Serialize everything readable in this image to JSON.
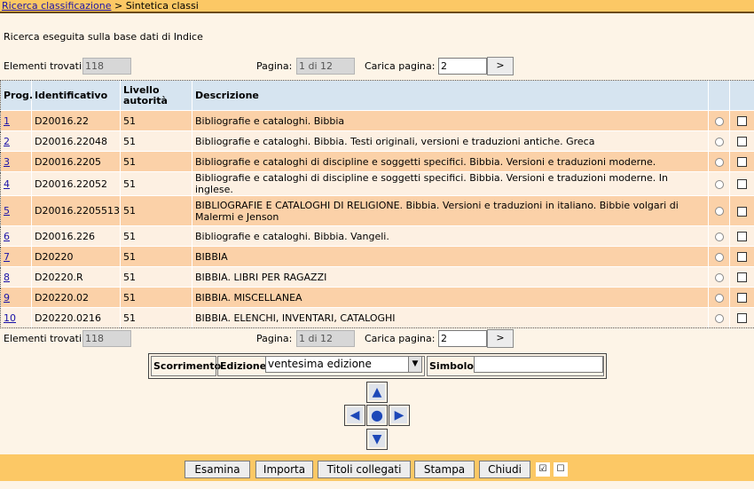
{
  "breadcrumb": {
    "link": "Ricerca classificazione",
    "separator": " > ",
    "current": "Sintetica classi"
  },
  "info_text": "Ricerca eseguita sulla base dati di Indice",
  "pager": {
    "found_label": "Elementi trovati:",
    "found_value": "118",
    "page_label": "Pagina:",
    "page_value": "1 di 12",
    "load_label": "Carica pagina:",
    "load_value": "2",
    "go_label": ">"
  },
  "table": {
    "headers": {
      "prog": "Prog.",
      "id": "Identificativo",
      "level": "Livello autorità",
      "desc": "Descrizione"
    },
    "rows": [
      {
        "prog": "1",
        "id": "D20016.22",
        "level": "51",
        "desc": "Bibliografie e cataloghi. Bibbia"
      },
      {
        "prog": "2",
        "id": "D20016.22048",
        "level": "51",
        "desc": "Bibliografie e cataloghi. Bibbia. Testi originali, versioni e traduzioni antiche. Greca"
      },
      {
        "prog": "3",
        "id": "D20016.2205",
        "level": "51",
        "desc": "Bibliografie e cataloghi di discipline e soggetti specifici. Bibbia. Versioni e traduzioni moderne."
      },
      {
        "prog": "4",
        "id": "D20016.22052",
        "level": "51",
        "desc": "Bibliografie e cataloghi di discipline e soggetti specifici. Bibbia. Versioni e traduzioni moderne. In inglese."
      },
      {
        "prog": "5",
        "id": "D20016.2205513",
        "level": "51",
        "desc": "BIBLIOGRAFIE E CATALOGHI DI RELIGIONE. Bibbia. Versioni e traduzioni in italiano. Bibbie volgari di Malermi e Jenson"
      },
      {
        "prog": "6",
        "id": "D20016.226",
        "level": "51",
        "desc": "Bibliografie e cataloghi. Bibbia. Vangeli."
      },
      {
        "prog": "7",
        "id": "D20220",
        "level": "51",
        "desc": "BIBBIA"
      },
      {
        "prog": "8",
        "id": "D20220.R",
        "level": "51",
        "desc": "BIBBIA. LIBRI PER RAGAZZI"
      },
      {
        "prog": "9",
        "id": "D20220.02",
        "level": "51",
        "desc": "BIBBIA. MISCELLANEA"
      },
      {
        "prog": "10",
        "id": "D20220.0216",
        "level": "51",
        "desc": "BIBBIA. ELENCHI, INVENTARI, CATALOGHI"
      }
    ]
  },
  "controls": {
    "scroll_label": "Scorrimento",
    "edition_label": "Edizione",
    "edition_value": "ventesima edizione",
    "symbol_label": "Simbolo",
    "symbol_value": ""
  },
  "nav_icons": {
    "up": "arrow-up-icon",
    "left": "arrow-left-icon",
    "center": "center-dot-icon",
    "right": "arrow-right-icon",
    "down": "arrow-down-icon"
  },
  "buttons": {
    "examine": "Esamina",
    "import": "Importa",
    "linked_titles": "Titoli collegati",
    "print": "Stampa",
    "close": "Chiudi"
  },
  "colors": {
    "topbar": "#fcc865",
    "odd_row": "#fbd1a8",
    "even_row": "#fdf0e2",
    "header": "#d6e4f0",
    "link": "#1a13a8"
  }
}
